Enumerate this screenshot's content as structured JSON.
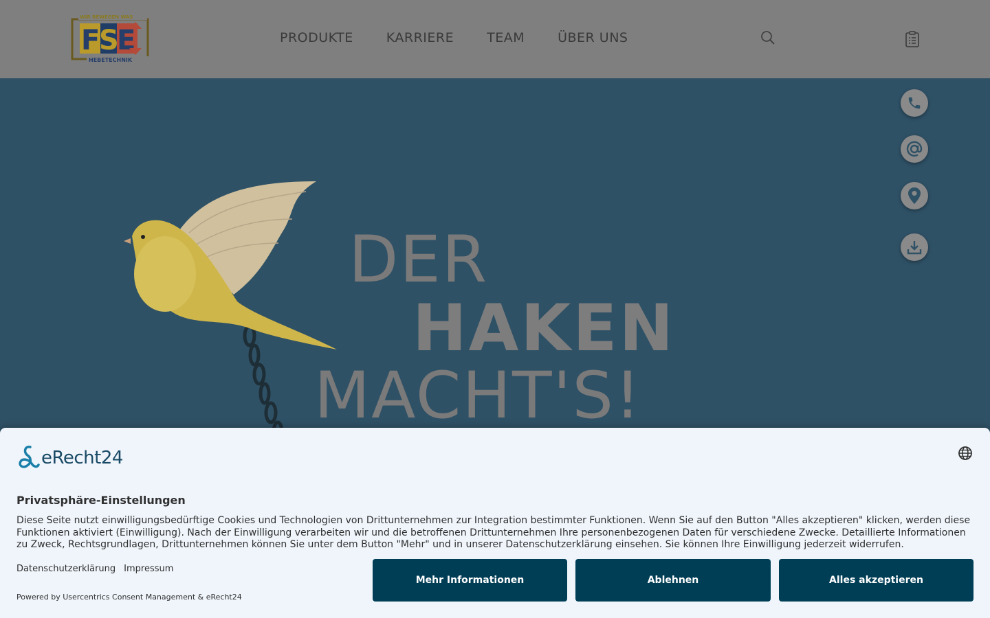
{
  "header": {
    "logo_tagline": "WIR BEWEGEN WAS",
    "logo_letters": "FSE",
    "logo_sub": "HEBETECHNIK",
    "nav": [
      "PRODUKTE",
      "KARRIERE",
      "TEAM",
      "ÜBER UNS"
    ]
  },
  "hero": {
    "line1": "DER",
    "line2": "HAKEN",
    "line3": "MACHT'S!",
    "side_buttons": [
      "phone-icon",
      "at-icon",
      "location-pin-icon",
      "download-icon"
    ]
  },
  "consent": {
    "brand": "eRecht24",
    "title": "Privatsphäre-Einstellungen",
    "text": "Diese Seite nutzt einwilligungsbedürftige Cookies und Technologien von Drittunternehmen zur Integration bestimmter Funktionen. Wenn Sie auf den Button \"Alles akzeptieren\" klicken, werden diese Funktionen aktiviert (Einwilligung). Nach der Einwilligung verarbeiten wir und die betroffenen Drittunternehmen Ihre personenbezogenen Daten für verschiedene Zwecke. Detaillierte Informationen zu Zweck, Rechtsgrundlagen, Drittunternehmen können Sie unter dem Button \"Mehr\" und in unserer Datenschutzerklärung einsehen. Sie können Ihre Einwilligung jederzeit widerrufen.",
    "link_privacy": "Datenschutzerklärung",
    "link_imprint": "Impressum",
    "powered": "Powered by Usercentrics Consent Management & eRecht24",
    "btn_more": "Mehr Informationen",
    "btn_decline": "Ablehnen",
    "btn_accept": "Alles akzeptieren"
  },
  "colors": {
    "header_bg": "#7f7f7f",
    "hero_bg": "#2f5166",
    "consent_bg": "#eff5fb",
    "button_bg": "#003e56"
  }
}
